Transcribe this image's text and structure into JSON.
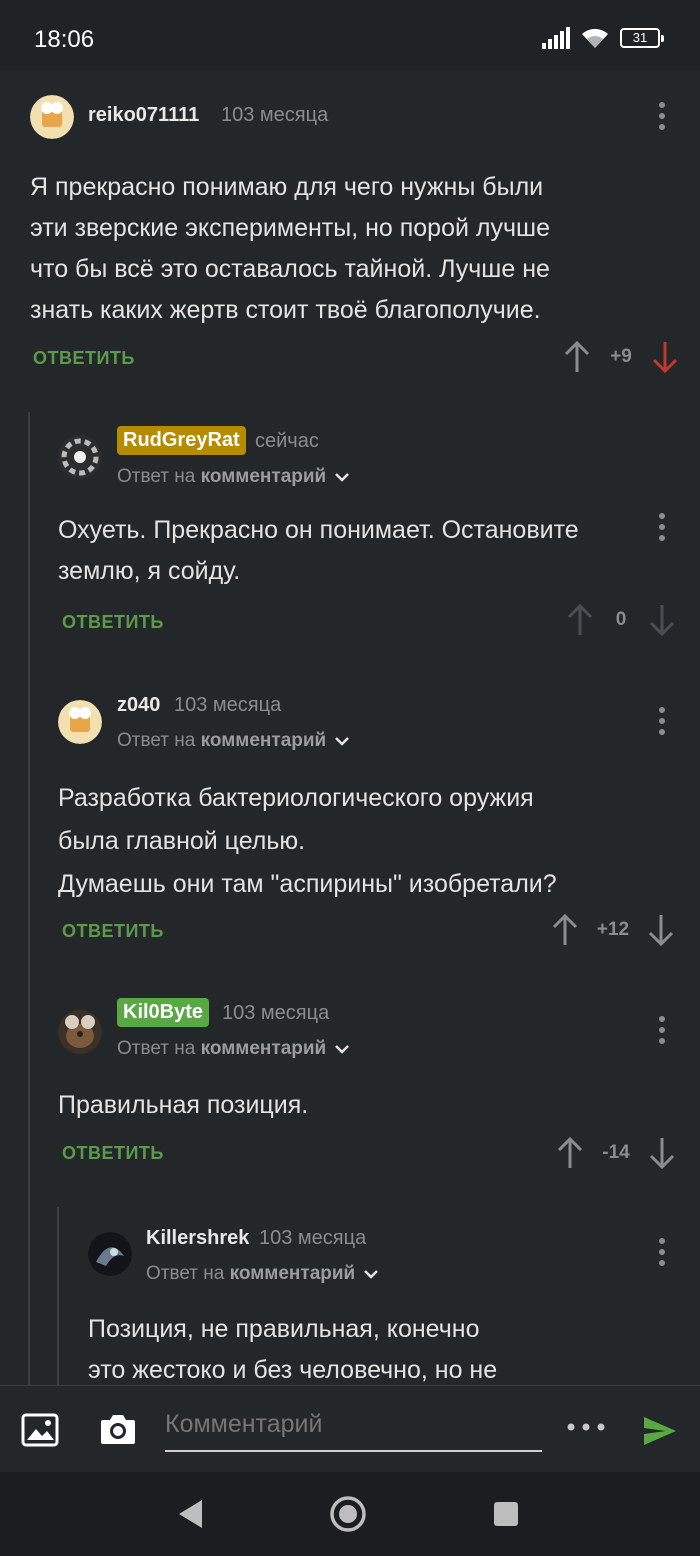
{
  "status_bar": {
    "time": "18:06",
    "battery": "31"
  },
  "comments": [
    {
      "username": "reiko071111",
      "time": "103 месяца",
      "lines": [
        "Я прекрасно понимаю для чего нужны были",
        "эти зверские эксперименты, но порой лучше",
        "что бы всё это оставалось тайной. Лучше не",
        "знать каких жертв стоит твоё благополучие."
      ],
      "reply_label": "ОТВЕТИТЬ",
      "score": "+9"
    },
    {
      "username": "RudGreyRat",
      "badge_color": "#b58c00",
      "time": "сейчас",
      "reply_to_prefix": "Ответ на",
      "reply_to_target": "комментарий",
      "lines": [
        "Охуеть. Прекрасно он понимает. Остановите",
        "землю, я сойду."
      ],
      "reply_label": "ОТВЕТИТЬ",
      "score": "0"
    },
    {
      "username": "z040",
      "time": "103 месяца",
      "reply_to_prefix": "Ответ на",
      "reply_to_target": "комментарий",
      "lines": [
        "Разработка бактериологического оружия",
        "была главной целью.",
        "Думаешь они там \"аспирины\" изобретали?"
      ],
      "reply_label": "ОТВЕТИТЬ",
      "score": "+12"
    },
    {
      "username": "Kil0Byte",
      "badge_color": "#5aa843",
      "time": "103 месяца",
      "reply_to_prefix": "Ответ на",
      "reply_to_target": "комментарий",
      "lines": [
        "Правильная позиция."
      ],
      "reply_label": "ОТВЕТИТЬ",
      "score": "-14"
    },
    {
      "username": "Killershrek",
      "time": "103 месяца",
      "reply_to_prefix": "Ответ на",
      "reply_to_target": "комментарий",
      "lines": [
        "Позиция, не правильная, конечно",
        "это жестоко и без человечно, но не"
      ]
    }
  ],
  "compose": {
    "placeholder": "Комментарий"
  },
  "colors": {
    "reply_green": "#5c9a4a",
    "downvote_red": "#c0392b",
    "send_green": "#5aa843"
  }
}
